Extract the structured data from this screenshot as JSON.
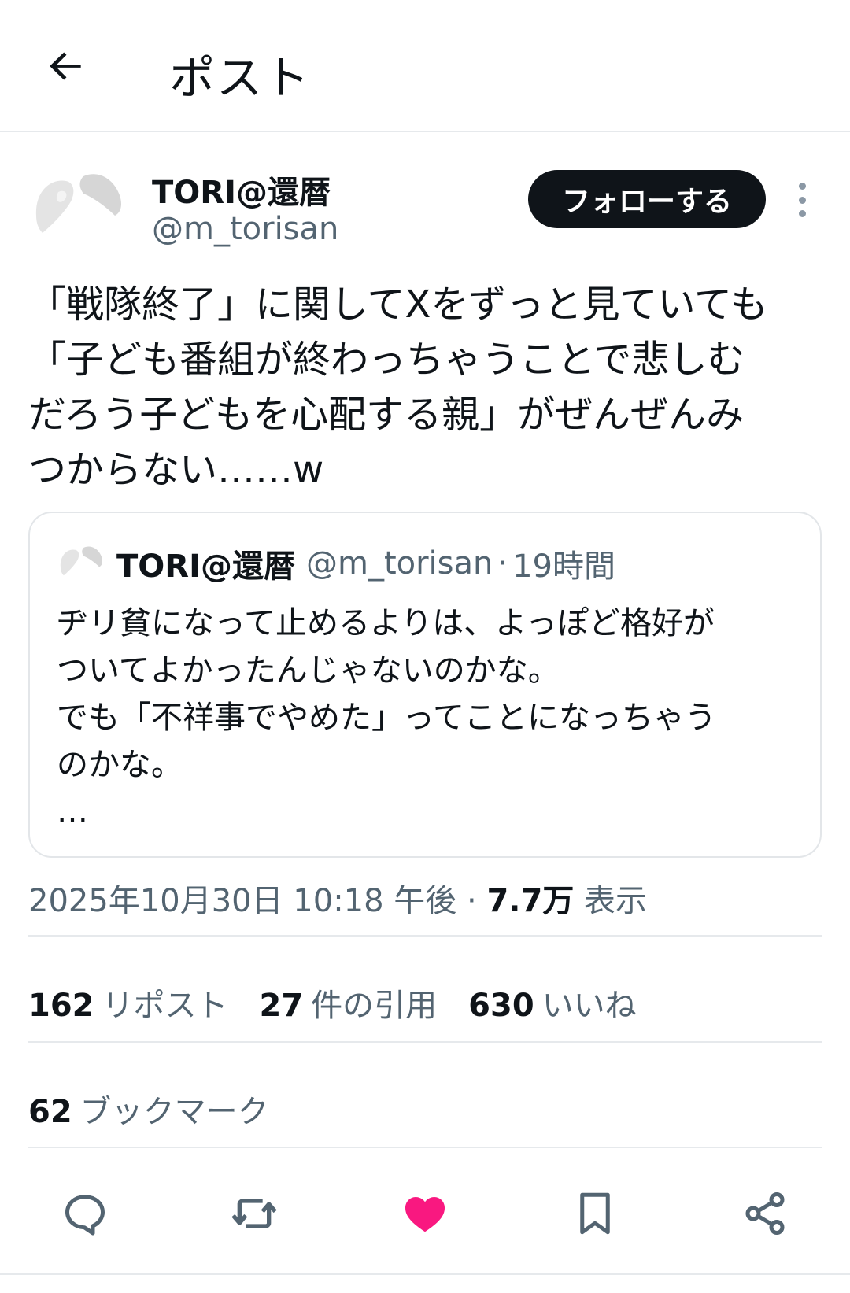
{
  "header": {
    "title": "ポスト",
    "back_icon": "arrow-left-icon"
  },
  "author": {
    "name": "TORI@還暦",
    "handle": "@m_torisan",
    "follow_label": "フォローする",
    "more_icon": "more-vertical-icon"
  },
  "tweet": {
    "lines": [
      "「戦隊終了」に関してXをずっと見ていても",
      "「子ども番組が終わっちゃうことで悲しむ",
      "だろう子どもを心配する親」がぜんぜんみ",
      "つからない……w"
    ]
  },
  "quote": {
    "name": "TORI@還暦",
    "handle": "@m_torisan",
    "separator": "·",
    "time": "19時間",
    "lines": [
      "ヂリ貧になって止めるよりは、よっぽど格好が",
      "ついてよかったんじゃないのかな。",
      "でも「不祥事でやめた」ってことになっちゃう",
      "のかな。",
      "…"
    ]
  },
  "meta": {
    "datetime": "2025年10月30日 10:18 午後",
    "separator": "·",
    "views_count": "7.7万",
    "views_label": "表示"
  },
  "stats": {
    "reposts_count": "162",
    "reposts_label": "リポスト",
    "quotes_count": "27",
    "quotes_label": "件の引用",
    "likes_count": "630",
    "likes_label": "いいね",
    "bookmarks_count": "62",
    "bookmarks_label": "ブックマーク"
  },
  "actions": {
    "icons": [
      "reply-icon",
      "repost-icon",
      "like-icon",
      "bookmark-icon",
      "share-icon"
    ],
    "like_color": "#f91880"
  },
  "colors": {
    "text": "#0f1419",
    "secondary": "#536471",
    "border": "#e6e9ec",
    "follow_bg": "#0f1419"
  }
}
